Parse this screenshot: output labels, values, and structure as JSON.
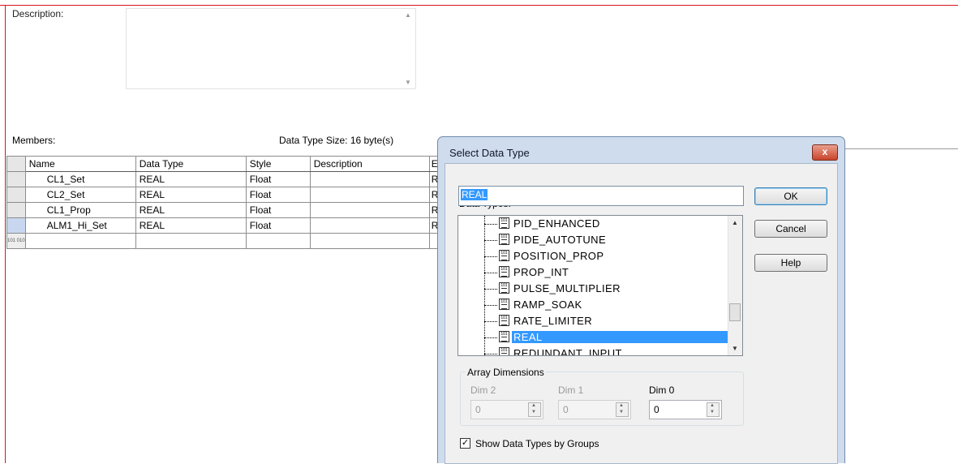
{
  "editor": {
    "description_label": "Description:",
    "members_label": "Members:",
    "size_label": "Data Type Size: 16 byte(s)"
  },
  "grid": {
    "columns": [
      "Name",
      "Data Type",
      "Style",
      "Description",
      "E"
    ],
    "rows": [
      {
        "name": "CL1_Set",
        "type": "REAL",
        "style": "Float",
        "desc": "",
        "extra": "R"
      },
      {
        "name": "CL2_Set",
        "type": "REAL",
        "style": "Float",
        "desc": "",
        "extra": "R"
      },
      {
        "name": "CL1_Prop",
        "type": "REAL",
        "style": "Float",
        "desc": "",
        "extra": "R"
      },
      {
        "name": "ALM1_Hi_Set",
        "type": "REAL",
        "style": "Float",
        "desc": "",
        "extra": "R"
      }
    ],
    "new_row_marker": "101 010"
  },
  "dialog": {
    "title": "Select Data Type",
    "close_label": "x",
    "data_types_label": "Data Types:",
    "data_types_value": "REAL",
    "ok_label": "OK",
    "cancel_label": "Cancel",
    "help_label": "Help",
    "tree_items": [
      "PID_ENHANCED",
      "PIDE_AUTOTUNE",
      "POSITION_PROP",
      "PROP_INT",
      "PULSE_MULTIPLIER",
      "RAMP_SOAK",
      "RATE_LIMITER",
      "REAL",
      "REDUNDANT_INPUT"
    ],
    "selected_item": "REAL",
    "array_dimensions_label": "Array Dimensions",
    "dims": [
      {
        "label": "Dim 2",
        "value": "0",
        "enabled": false
      },
      {
        "label": "Dim 1",
        "value": "0",
        "enabled": false
      },
      {
        "label": "Dim 0",
        "value": "0",
        "enabled": true
      }
    ],
    "show_groups_label": "Show Data Types by Groups",
    "show_groups_checked": true
  }
}
